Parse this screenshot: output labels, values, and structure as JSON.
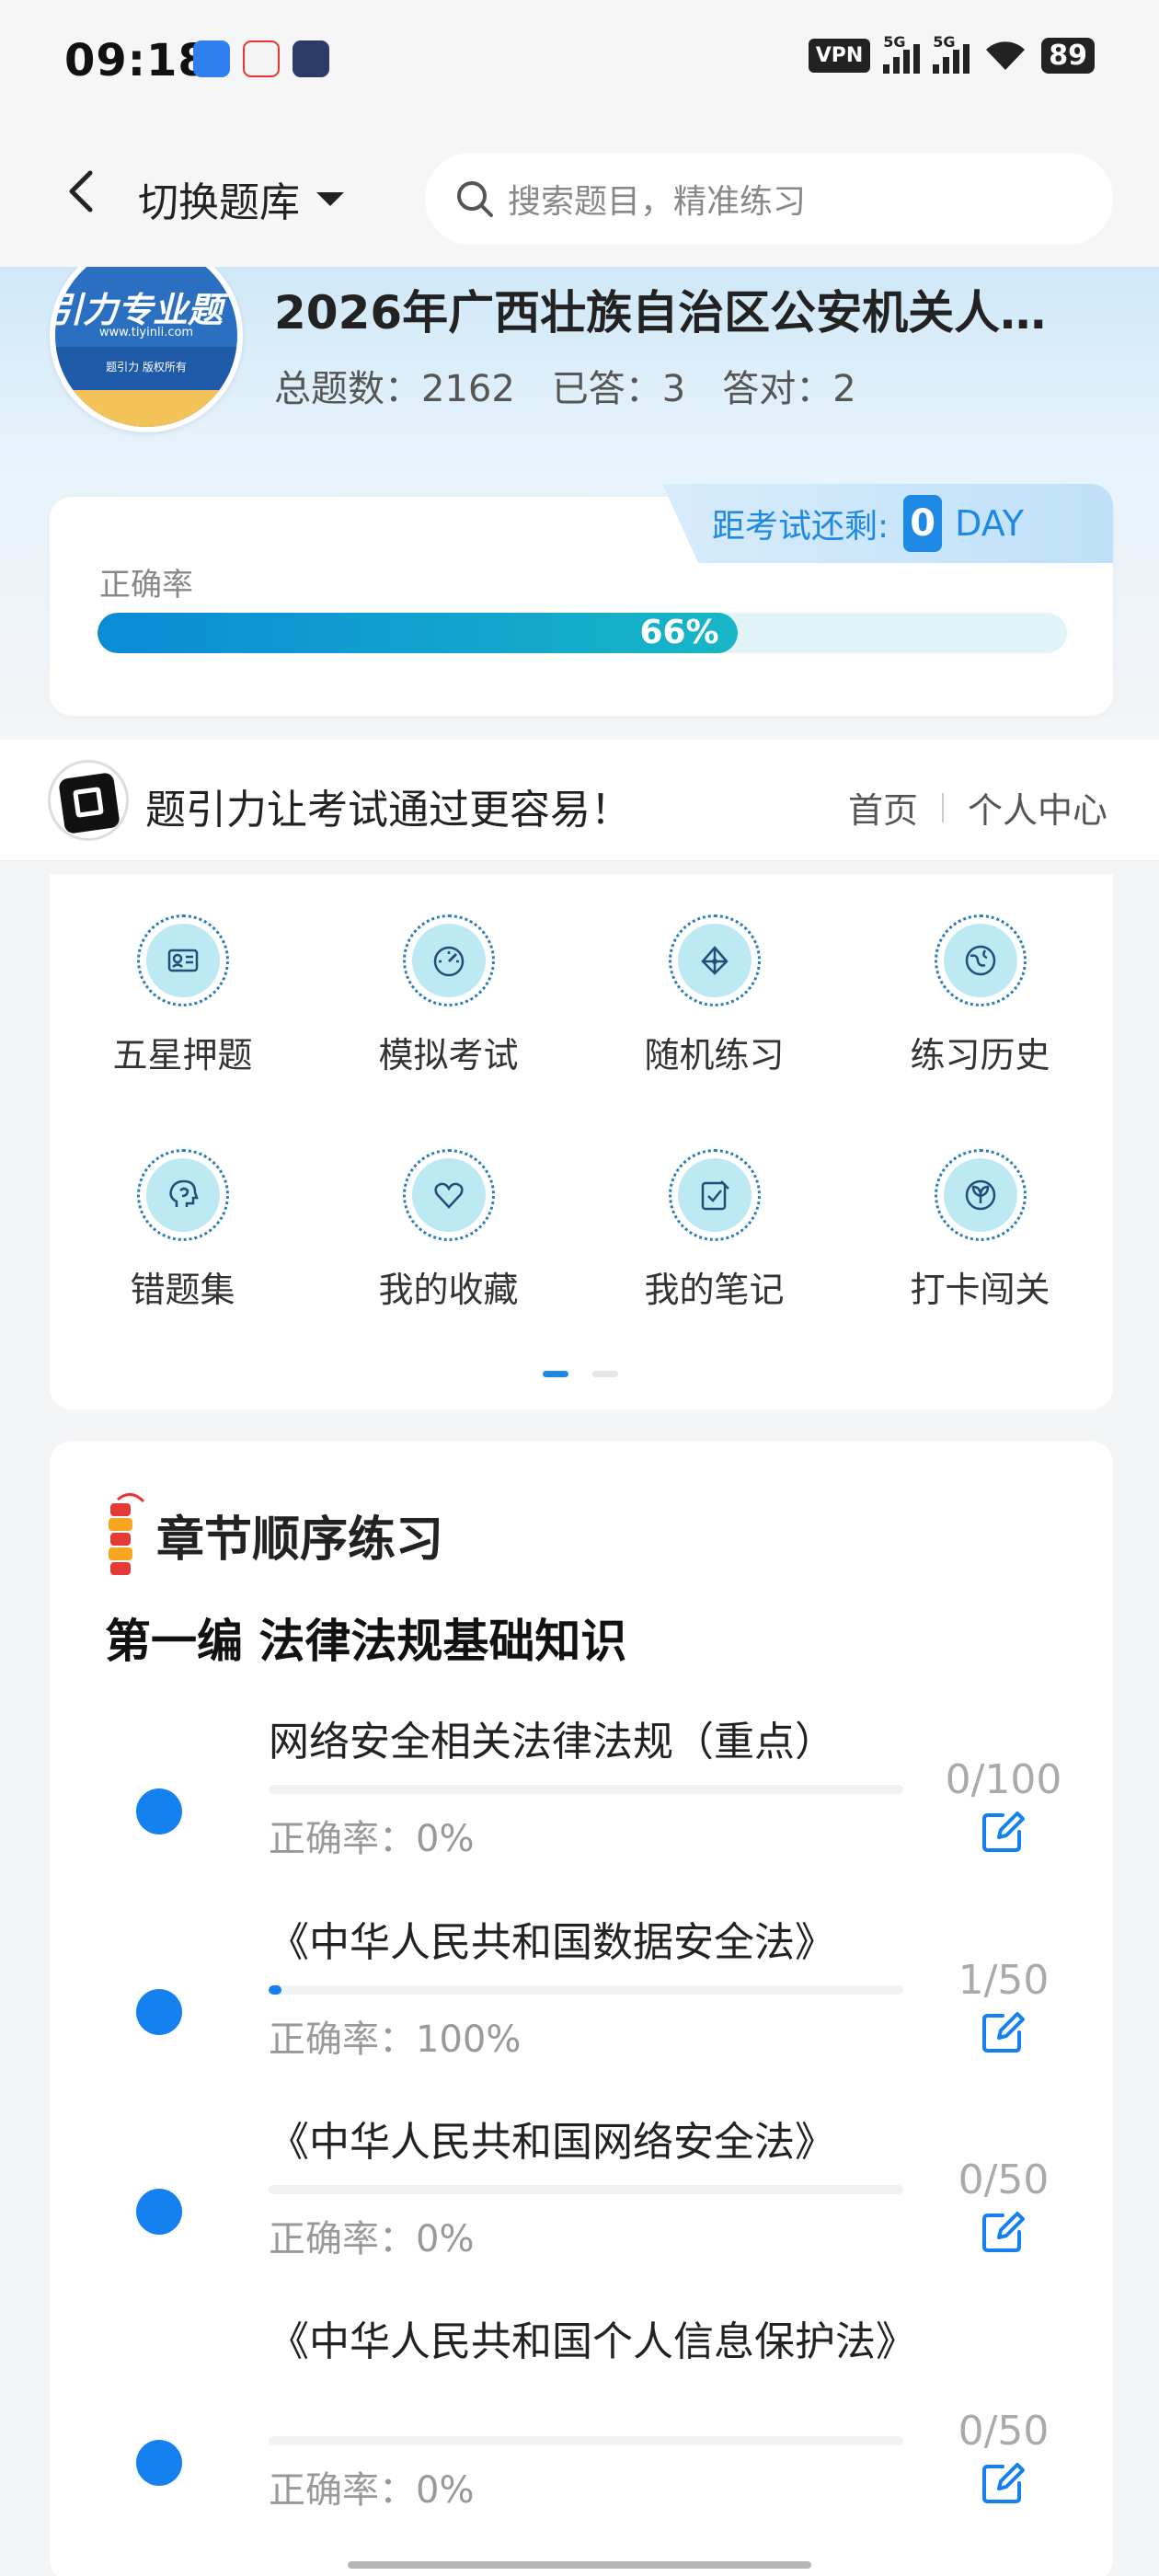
{
  "status_bar": {
    "time": "09:18",
    "vpn": "VPN",
    "net1": "5G",
    "net2": "5G",
    "battery": "89"
  },
  "header": {
    "switch_label": "切换题库",
    "search_placeholder": "搜索题目，精准练习"
  },
  "bank": {
    "logo_text": "引力专业题",
    "logo_url": "www.tiyinli.com",
    "logo_copyright": "题引力 版权所有",
    "title": "2026年广西壮族自治区公安机关人…",
    "total_label": "总题数：2162",
    "answered_label": "已答：3",
    "correct_label": "答对：2"
  },
  "countdown": {
    "label": "距考试还剩:",
    "days": "0",
    "unit": "DAY"
  },
  "accuracy": {
    "label": "正确率",
    "percent_text": "66%",
    "value": 0.66
  },
  "banner": {
    "slogan": "题引力让考试通过更容易！",
    "home": "首页",
    "profile": "个人中心"
  },
  "menu": [
    {
      "label": "五星押题",
      "icon": "id-card-icon"
    },
    {
      "label": "模拟考试",
      "icon": "speedometer-icon"
    },
    {
      "label": "随机练习",
      "icon": "network-icon"
    },
    {
      "label": "练习历史",
      "icon": "globe-icon"
    },
    {
      "label": "错题集",
      "icon": "head-icon"
    },
    {
      "label": "我的收藏",
      "icon": "heart-icon"
    },
    {
      "label": "我的笔记",
      "icon": "note-check-icon"
    },
    {
      "label": "打卡闯关",
      "icon": "leaf-icon"
    }
  ],
  "chapter": {
    "heading": "章节顺序练习",
    "part": "第一编 法律法规基础知识",
    "items": [
      {
        "title": "网络安全相关法律法规（重点）",
        "accuracy": "正确率：0%",
        "count": "0/100",
        "progress": 0.0
      },
      {
        "title": "《中华人民共和国数据安全法》",
        "accuracy": "正确率：100%",
        "count": "1/50",
        "progress": 0.02
      },
      {
        "title": "《中华人民共和国网络安全法》",
        "accuracy": "正确率：0%",
        "count": "0/50",
        "progress": 0.0
      },
      {
        "title": "《中华人民共和国个人信息保护法》",
        "accuracy": "正确率：0%",
        "count": "0/50",
        "progress": 0.0
      }
    ]
  }
}
